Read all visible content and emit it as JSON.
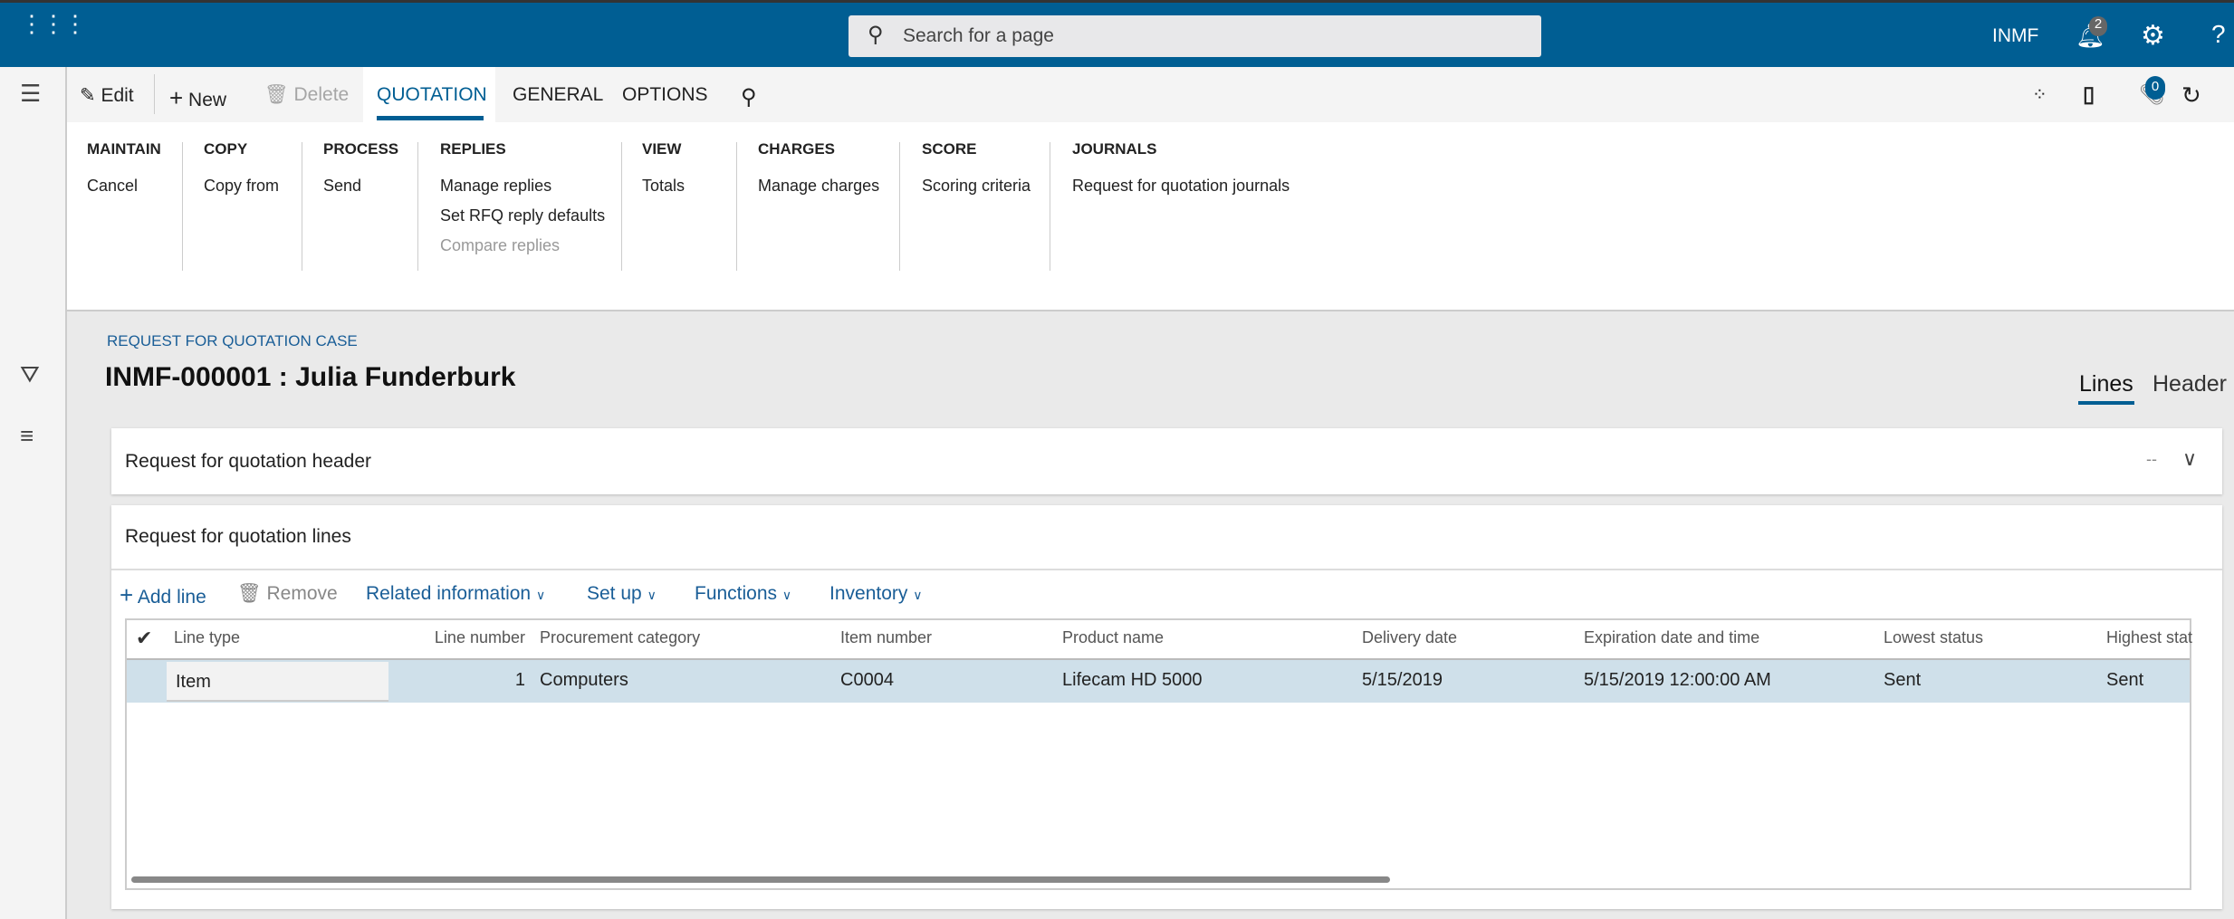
{
  "topbar": {
    "search_placeholder": "Search for a page",
    "company": "INMF",
    "notification_count": "2",
    "brand_color": "#005e93"
  },
  "actionbar": {
    "edit": "Edit",
    "new": "New",
    "delete": "Delete",
    "tabs": [
      "QUOTATION",
      "GENERAL",
      "OPTIONS"
    ],
    "attachments_count": "0"
  },
  "ribbon": {
    "groups": [
      {
        "title": "MAINTAIN",
        "items": [
          "Cancel"
        ]
      },
      {
        "title": "COPY",
        "items": [
          "Copy from"
        ]
      },
      {
        "title": "PROCESS",
        "items": [
          "Send"
        ]
      },
      {
        "title": "REPLIES",
        "items": [
          "Manage replies",
          "Set RFQ reply defaults",
          "Compare replies"
        ]
      },
      {
        "title": "VIEW",
        "items": [
          "Totals"
        ]
      },
      {
        "title": "CHARGES",
        "items": [
          "Manage charges"
        ]
      },
      {
        "title": "SCORE",
        "items": [
          "Scoring criteria"
        ]
      },
      {
        "title": "JOURNALS",
        "items": [
          "Request for quotation journals"
        ]
      }
    ]
  },
  "page": {
    "breadcrumb": "REQUEST FOR QUOTATION CASE",
    "title": "INMF-000001 : Julia Funderburk",
    "view_tabs": [
      "Lines",
      "Header"
    ]
  },
  "header_section": {
    "title": "Request for quotation header",
    "summary": "--"
  },
  "lines_section": {
    "title": "Request for quotation lines",
    "toolbar": [
      "Add line",
      "Remove",
      "Related information",
      "Set up",
      "Functions",
      "Inventory"
    ],
    "columns": [
      "Line type",
      "Line number",
      "Procurement category",
      "Item number",
      "Product name",
      "Delivery date",
      "Expiration date and time",
      "Lowest status",
      "Highest stat"
    ],
    "rows": [
      [
        "Item",
        "1",
        "Computers",
        "C0004",
        "Lifecam HD 5000",
        "5/15/2019",
        "5/15/2019 12:00:00 AM",
        "Sent",
        "Sent"
      ]
    ]
  }
}
